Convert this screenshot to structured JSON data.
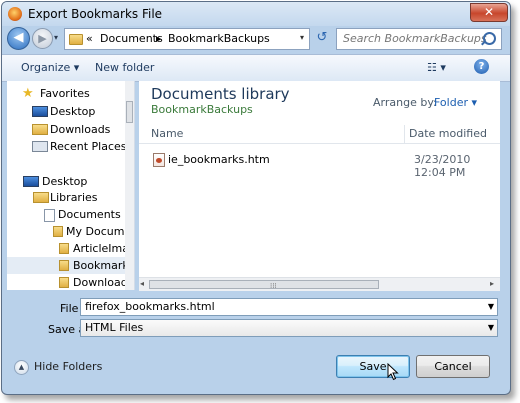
{
  "window": {
    "title": "Export Bookmarks File",
    "close_label": "✕"
  },
  "nav": {
    "back_glyph": "◀",
    "forward_glyph": "▶",
    "history_glyph": "▾",
    "breadcrumb": [
      "«",
      "Documents",
      "▸",
      "BookmarkBackups"
    ],
    "address_dropdown_glyph": "▾",
    "refresh_glyph": "↺",
    "search_placeholder": "Search BookmarkBackups"
  },
  "toolbar": {
    "organize_label": "Organize ▾",
    "new_folder_label": "New folder",
    "view_glyph": "☷ ▾",
    "help_glyph": "?"
  },
  "sidebar": {
    "items": [
      {
        "label": "Favorites",
        "icon": "star-icon"
      },
      {
        "label": "Desktop",
        "icon": "desktop-icon"
      },
      {
        "label": "Downloads",
        "icon": "downloads-folder-icon"
      },
      {
        "label": "Recent Places",
        "icon": "recent-places-icon"
      },
      {
        "label": "Desktop",
        "icon": "desktop-icon"
      },
      {
        "label": "Libraries",
        "icon": "libraries-icon"
      },
      {
        "label": "Documents",
        "icon": "documents-icon"
      },
      {
        "label": "My Documen",
        "icon": "folder-icon"
      },
      {
        "label": "ArticleImag",
        "icon": "folder-icon"
      },
      {
        "label": "BookmarkB",
        "icon": "folder-icon"
      },
      {
        "label": "Downloads",
        "icon": "folder-icon"
      }
    ]
  },
  "main": {
    "library_title": "Documents library",
    "library_subtitle": "BookmarkBackups",
    "arrange_label": "Arrange by:",
    "arrange_value": "Folder ▾",
    "columns": {
      "name": "Name",
      "date": "Date modified"
    },
    "files": [
      {
        "name": "ie_bookmarks.htm",
        "date": "3/23/2010 12:04 PM",
        "icon": "html-file-icon"
      }
    ],
    "hscroll_grip": "⁞⁞⁞",
    "scroll_left_glyph": "◂",
    "scroll_right_glyph": "▸"
  },
  "form": {
    "file_name_label": "File name:",
    "file_name_value": "firefox_bookmarks.html",
    "save_type_label": "Save as type:",
    "save_type_value": "HTML Files",
    "dropdown_glyph": "▼"
  },
  "footer": {
    "hide_folders_label": "Hide Folders",
    "hide_folders_glyph": "▲",
    "save_label": "Save",
    "cancel_label": "Cancel"
  }
}
